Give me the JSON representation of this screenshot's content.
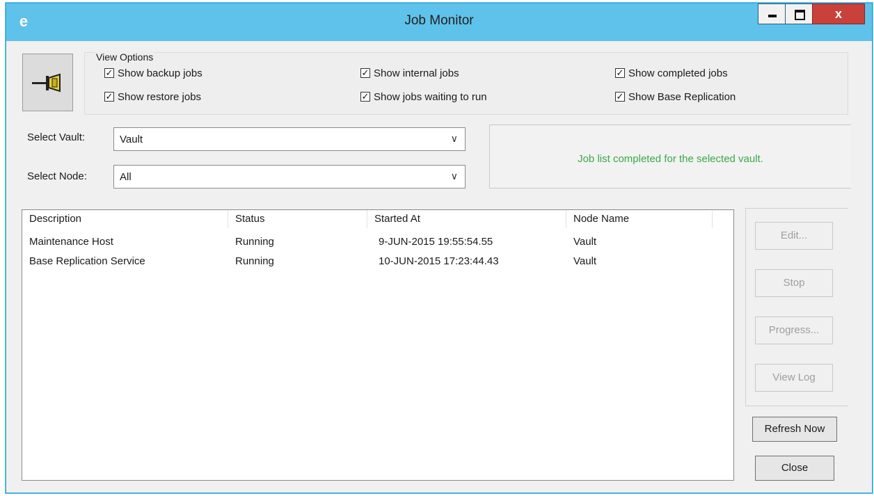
{
  "window": {
    "title": "Job Monitor",
    "app_icon": "e",
    "controls": {
      "minimize_icon": "minimize-icon",
      "maximize_icon": "maximize-icon",
      "close_glyph": "x"
    }
  },
  "view_options": {
    "label": "View Options",
    "checkboxes": [
      {
        "label": "Show backup jobs",
        "checked": true
      },
      {
        "label": "Show internal jobs",
        "checked": true
      },
      {
        "label": "Show completed jobs",
        "checked": true
      },
      {
        "label": "Show restore jobs",
        "checked": true
      },
      {
        "label": "Show jobs waiting to run",
        "checked": true
      },
      {
        "label": "Show Base Replication",
        "checked": true
      }
    ],
    "check_glyph": "✓"
  },
  "selectors": {
    "vault_label": "Select Vault:",
    "vault_value": "Vault",
    "node_label": "Select Node:",
    "node_value": "All",
    "arrow": "∨"
  },
  "status_message": "Job list completed for the selected vault.",
  "status_color": "#3aa84a",
  "job_list": {
    "columns": [
      "Description",
      "Status",
      "Started At",
      "Node Name"
    ],
    "rows": [
      [
        "Maintenance Host",
        "Running",
        "9-JUN-2015 19:55:54.55",
        "Vault"
      ],
      [
        "Base Replication Service",
        "Running",
        "10-JUN-2015 17:23:44.43",
        "Vault"
      ]
    ]
  },
  "buttons": {
    "edit": "Edit...",
    "stop": "Stop",
    "progress": "Progress...",
    "view_log": "View Log",
    "refresh_now": "Refresh Now",
    "close": "Close"
  }
}
